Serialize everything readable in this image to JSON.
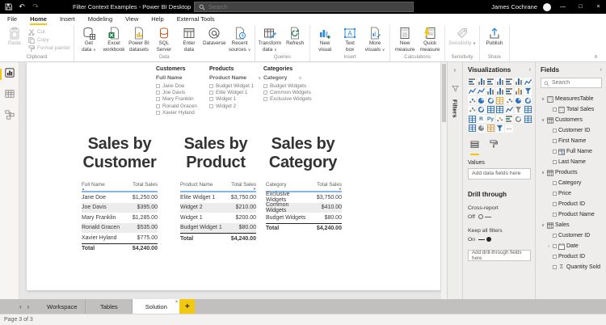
{
  "titlebar": {
    "title": "Filter Context Examples - Power BI Desktop",
    "search_placeholder": "Search",
    "user": "James Cochrane",
    "window": {
      "minimize": "—",
      "restore": "□",
      "close": "×"
    }
  },
  "menu": {
    "items": [
      {
        "label": "File",
        "active": false
      },
      {
        "label": "Home",
        "active": true
      },
      {
        "label": "Insert",
        "active": false
      },
      {
        "label": "Modeling",
        "active": false
      },
      {
        "label": "View",
        "active": false
      },
      {
        "label": "Help",
        "active": false
      },
      {
        "label": "External Tools",
        "active": false
      }
    ]
  },
  "ribbon": {
    "collapse_glyph": "∧",
    "groups": [
      {
        "label": "Clipboard",
        "layout": "clipboard",
        "large": {
          "label": "Paste",
          "icon": "paste",
          "disabled": true
        },
        "small": [
          {
            "label": "Cut",
            "icon": "cut",
            "disabled": true
          },
          {
            "label": "Copy",
            "icon": "copy",
            "disabled": true
          },
          {
            "label": "Format painter",
            "icon": "format-painter",
            "disabled": true
          }
        ]
      },
      {
        "label": "Data",
        "buttons": [
          {
            "lines": [
              "Get",
              "data"
            ],
            "icon": "get-data",
            "dropdown": true
          },
          {
            "lines": [
              "Excel",
              "workbook"
            ],
            "icon": "excel-workbook"
          },
          {
            "lines": [
              "Power BI",
              "datasets"
            ],
            "icon": "powerbi-datasets"
          },
          {
            "lines": [
              "SQL",
              "Server"
            ],
            "icon": "sql-server"
          },
          {
            "lines": [
              "Enter",
              "data"
            ],
            "icon": "enter-data"
          },
          {
            "lines": [
              "Dataverse"
            ],
            "icon": "dataverse"
          },
          {
            "lines": [
              "Recent",
              "sources"
            ],
            "icon": "recent-sources",
            "dropdown": true
          }
        ]
      },
      {
        "label": "Queries",
        "buttons": [
          {
            "lines": [
              "Transform",
              "data"
            ],
            "icon": "transform-data",
            "dropdown": true
          },
          {
            "lines": [
              "Refresh"
            ],
            "icon": "refresh"
          }
        ]
      },
      {
        "label": "Insert",
        "buttons": [
          {
            "lines": [
              "New",
              "visual"
            ],
            "icon": "new-visual"
          },
          {
            "lines": [
              "Text",
              "box"
            ],
            "icon": "text-box"
          },
          {
            "lines": [
              "More",
              "visuals"
            ],
            "icon": "more-visuals",
            "dropdown": true
          }
        ]
      },
      {
        "label": "Calculations",
        "buttons": [
          {
            "lines": [
              "New",
              "measure"
            ],
            "icon": "new-measure"
          },
          {
            "lines": [
              "Quick",
              "measure"
            ],
            "icon": "quick-measure"
          }
        ]
      },
      {
        "label": "Sensitivity",
        "buttons": [
          {
            "lines": [
              "Sensitivity"
            ],
            "icon": "sensitivity",
            "dropdown": true,
            "disabled": true
          }
        ]
      },
      {
        "label": "Share",
        "buttons": [
          {
            "lines": [
              "Publish"
            ],
            "icon": "publish"
          }
        ]
      }
    ]
  },
  "view_rail": {
    "items": [
      {
        "name": "report-view",
        "active": true
      },
      {
        "name": "data-view",
        "active": false
      },
      {
        "name": "model-view",
        "active": false
      }
    ]
  },
  "canvas": {
    "slicers": [
      {
        "group_title": "Customers",
        "header": "Full Name",
        "has_chevron": false,
        "items": [
          "Jane Doe",
          "Joe Davis",
          "Mary Franklin",
          "Ronald Gracen",
          "Xavier Hyland"
        ]
      },
      {
        "group_title": "Products",
        "header": "Product Name",
        "has_chevron": true,
        "items": [
          "Budget Widget 1",
          "Elite Widget 1",
          "Widget 1",
          "Widget 2"
        ]
      },
      {
        "group_title": "Categories",
        "header": "Category",
        "has_chevron": true,
        "items": [
          "Budget Widgets",
          "Common Widgets",
          "Exclusive Widgets"
        ]
      }
    ],
    "visuals": [
      {
        "title_lines": [
          "Sales by",
          "Customer"
        ],
        "columns": [
          "Full Name",
          "Total Sales"
        ],
        "sort": {
          "column": 0,
          "dir": "asc"
        },
        "rows": [
          [
            "Jane Doe",
            "$1,250.00"
          ],
          [
            "Joe Davis",
            "$395.00"
          ],
          [
            "Mary Franklin",
            "$1,285.00"
          ],
          [
            "Ronald Gracen",
            "$535.00"
          ],
          [
            "Xavier Hyland",
            "$775.00"
          ]
        ],
        "total": [
          "Total",
          "$4,240.00"
        ]
      },
      {
        "title_lines": [
          "Sales by",
          "Product"
        ],
        "columns": [
          "Product Name",
          "Total Sales"
        ],
        "sort": {
          "column": 1,
          "dir": "desc"
        },
        "rows": [
          [
            "Elite Widget 1",
            "$3,750.00"
          ],
          [
            "Widget 2",
            "$210.00"
          ],
          [
            "Widget 1",
            "$200.00"
          ],
          [
            "Budget Widget 1",
            "$80.00"
          ]
        ],
        "total": [
          "Total",
          "$4,240.00"
        ]
      },
      {
        "title_lines": [
          "Sales by",
          "Category"
        ],
        "columns": [
          "Category",
          "Total Sales"
        ],
        "sort": {
          "column": 1,
          "dir": "desc"
        },
        "rows": [
          [
            "Exclusive Widgets",
            "$3,750.00"
          ],
          [
            "Common Widgets",
            "$410.00"
          ],
          [
            "Budget Widgets",
            "$80.00"
          ]
        ],
        "total": [
          "Total",
          "$4,240.00"
        ]
      }
    ]
  },
  "filters_pane": {
    "label": "Filters",
    "expand_glyph": "‹"
  },
  "visualizations_pane": {
    "title": "Visualizations",
    "collapse_glyph": "›",
    "gallery": [
      {
        "name": "stacked-bar-chart",
        "glyph": "barsh"
      },
      {
        "name": "stacked-column-chart",
        "glyph": "bars"
      },
      {
        "name": "clustered-bar-chart",
        "glyph": "barsh"
      },
      {
        "name": "clustered-column-chart",
        "glyph": "bars"
      },
      {
        "name": "100-stacked-bar-chart",
        "glyph": "barsh"
      },
      {
        "name": "100-stacked-column-chart",
        "glyph": "bars"
      },
      {
        "name": "line-chart",
        "glyph": "line"
      },
      {
        "name": "area-chart",
        "glyph": "line"
      },
      {
        "name": "stacked-area-chart",
        "glyph": "line"
      },
      {
        "name": "line-and-stacked-column-chart",
        "glyph": "bars"
      },
      {
        "name": "line-and-clustered-column-chart",
        "glyph": "bars"
      },
      {
        "name": "ribbon-chart",
        "glyph": "barsh"
      },
      {
        "name": "waterfall-chart",
        "glyph": "bars",
        "color": "#e8a33d"
      },
      {
        "name": "funnel-chart",
        "glyph": "funnel"
      },
      {
        "name": "scatter-chart",
        "glyph": "dots"
      },
      {
        "name": "pie-chart",
        "glyph": "pie"
      },
      {
        "name": "donut-chart",
        "glyph": "donut"
      },
      {
        "name": "treemap",
        "glyph": "grid",
        "color": "#e8a33d"
      },
      {
        "name": "map",
        "glyph": "dots"
      },
      {
        "name": "filled-map",
        "glyph": "pie"
      },
      {
        "name": "shape-map",
        "glyph": "donut"
      },
      {
        "name": "azure-map",
        "glyph": "dots",
        "color": "#2f9e83"
      },
      {
        "name": "gauge",
        "glyph": "donut"
      },
      {
        "name": "card",
        "glyph": "grid"
      },
      {
        "name": "multi-row-card",
        "glyph": "grid"
      },
      {
        "name": "kpi",
        "glyph": "line"
      },
      {
        "name": "slicer",
        "glyph": "funnel",
        "color": "#8a8886"
      },
      {
        "name": "table",
        "glyph": "grid"
      },
      {
        "name": "matrix",
        "glyph": "grid"
      },
      {
        "name": "r-script-visual",
        "glyph": "R"
      },
      {
        "name": "python-visual",
        "glyph": "Py"
      },
      {
        "name": "key-influencers",
        "glyph": "dots",
        "color": "#e8a33d"
      },
      {
        "name": "decomposition-tree",
        "glyph": "barsh",
        "color": "#2f9e83"
      },
      {
        "name": "qa-visual",
        "glyph": "donut",
        "color": "#8a8886"
      },
      {
        "name": "smart-narrative",
        "glyph": "grid"
      },
      {
        "name": "paginated-report",
        "glyph": "grid"
      },
      {
        "name": "arcgis-map",
        "glyph": "pie",
        "color": "#8a8886"
      },
      {
        "name": "power-apps",
        "glyph": "grid",
        "color": "#d59644"
      },
      {
        "name": "power-automate",
        "glyph": "funnel",
        "color": "#2f6fb5"
      },
      {
        "name": "more-visuals-ellipsis",
        "glyph": "ellipsis"
      }
    ],
    "tabs": [
      {
        "name": "fields-tab",
        "active": true
      },
      {
        "name": "format-tab",
        "active": false
      }
    ],
    "values_label": "Values",
    "add_fields_placeholder": "Add data fields here",
    "drill_through": {
      "title": "Drill through",
      "cross_report_label": "Cross-report",
      "cross_report_state": "Off",
      "keep_filters_label": "Keep all filters",
      "keep_filters_state": "On",
      "add_fields_placeholder": "Add drill-through fields here"
    }
  },
  "fields_pane": {
    "title": "Fields",
    "collapse_glyph": "›",
    "search_placeholder": "Search",
    "tree": [
      {
        "label": "MeasuresTable",
        "level": 0,
        "expander": "expanded",
        "icon": "measure-table",
        "checkbox": false
      },
      {
        "label": "Total Sales",
        "level": 1,
        "expander": null,
        "icon": "measure",
        "checkbox": true
      },
      {
        "label": "Customers",
        "level": 0,
        "expander": "expanded",
        "icon": "table",
        "checkbox": false
      },
      {
        "label": "Customer ID",
        "level": 1,
        "expander": null,
        "icon": null,
        "checkbox": true
      },
      {
        "label": "First Name",
        "level": 1,
        "expander": null,
        "icon": null,
        "checkbox": true
      },
      {
        "label": "Full Name",
        "level": 1,
        "expander": null,
        "icon": "sorted-column",
        "checkbox": true
      },
      {
        "label": "Last Name",
        "level": 1,
        "expander": null,
        "icon": null,
        "checkbox": true
      },
      {
        "label": "Products",
        "level": 0,
        "expander": "expanded",
        "icon": "table",
        "checkbox": false
      },
      {
        "label": "Category",
        "level": 1,
        "expander": null,
        "icon": null,
        "checkbox": true
      },
      {
        "label": "Price",
        "level": 1,
        "expander": null,
        "icon": null,
        "checkbox": true
      },
      {
        "label": "Product ID",
        "level": 1,
        "expander": null,
        "icon": null,
        "checkbox": true
      },
      {
        "label": "Product Name",
        "level": 1,
        "expander": null,
        "icon": null,
        "checkbox": true
      },
      {
        "label": "Sales",
        "level": 0,
        "expander": "expanded",
        "icon": "table",
        "checkbox": false
      },
      {
        "label": "Customer ID",
        "level": 1,
        "expander": null,
        "icon": null,
        "checkbox": true
      },
      {
        "label": "Date",
        "level": 1,
        "expander": "collapsed",
        "icon": "calendar",
        "checkbox": true
      },
      {
        "label": "Product ID",
        "level": 1,
        "expander": null,
        "icon": null,
        "checkbox": true
      },
      {
        "label": "Quantity Sold",
        "level": 1,
        "expander": null,
        "icon": "sigma",
        "checkbox": true
      }
    ]
  },
  "page_tabs": {
    "nav": {
      "prev": "‹",
      "next": "›"
    },
    "tabs": [
      {
        "label": "Workspace",
        "active": false
      },
      {
        "label": "Tables",
        "active": false
      },
      {
        "label": "Solution",
        "active": true,
        "closable": true
      }
    ],
    "add_label": "+"
  },
  "status_bar": {
    "text": "Page 3 of 3"
  },
  "colors": {
    "accent": "#F2C811",
    "table_header_underline": "#84B6E8"
  }
}
